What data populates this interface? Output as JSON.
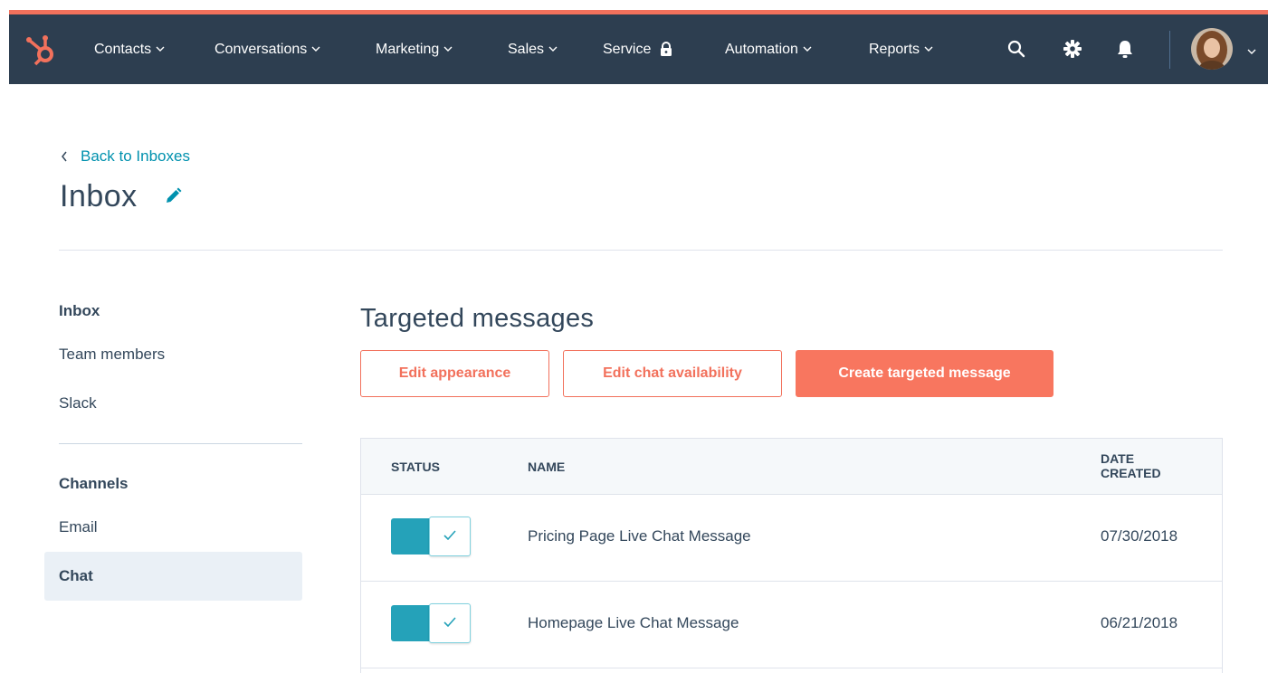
{
  "colors": {
    "nav_bg": "#2d3e50",
    "accent": "#f2715c",
    "link": "#0091ae",
    "toggle_on": "#25a2b9"
  },
  "nav": {
    "items": [
      {
        "label": "Contacts",
        "has_dropdown": true
      },
      {
        "label": "Conversations",
        "has_dropdown": true
      },
      {
        "label": "Marketing",
        "has_dropdown": true
      },
      {
        "label": "Sales",
        "has_dropdown": true
      },
      {
        "label": "Service",
        "locked": true
      },
      {
        "label": "Automation",
        "has_dropdown": true
      },
      {
        "label": "Reports",
        "has_dropdown": true
      }
    ],
    "icons": [
      "search-icon",
      "gear-icon",
      "bell-icon"
    ]
  },
  "back_link": "Back to Inboxes",
  "page_title": "Inbox",
  "sidebar": {
    "group1_heading": "Inbox",
    "group1_items": [
      "Team members",
      "Slack"
    ],
    "group2_heading": "Channels",
    "group2_items": [
      "Email",
      "Chat"
    ],
    "active_item": "Chat"
  },
  "main": {
    "section_title": "Targeted messages",
    "buttons": {
      "edit_appearance": "Edit appearance",
      "edit_availability": "Edit chat availability",
      "create": "Create targeted message"
    },
    "table": {
      "headers": {
        "status": "STATUS",
        "name": "NAME",
        "date_line1": "DATE",
        "date_line2": "CREATED"
      },
      "rows": [
        {
          "status_on": true,
          "name": "Pricing Page Live Chat Message",
          "date": "07/30/2018"
        },
        {
          "status_on": true,
          "name": "Homepage Live Chat Message",
          "date": "06/21/2018"
        }
      ]
    }
  }
}
